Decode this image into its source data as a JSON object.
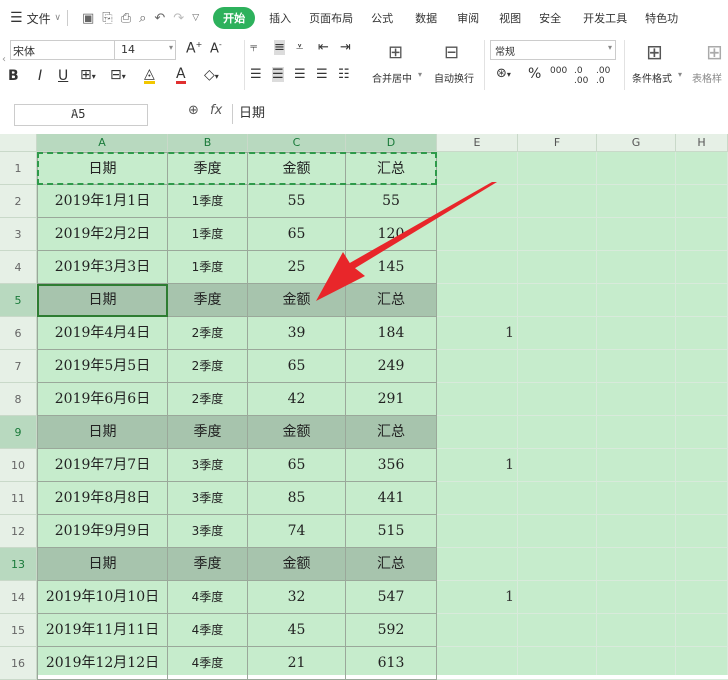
{
  "menu": {
    "file_label": "文件",
    "tabs": [
      "开始",
      "插入",
      "页面布局",
      "公式",
      "数据",
      "审阅",
      "视图",
      "安全",
      "开发工具",
      "特色功"
    ]
  },
  "ribbon": {
    "font_name": "宋体",
    "font_size": "14",
    "merge_label": "合并居中",
    "wrap_label": "自动换行",
    "number_format": "常规",
    "cond_format_label": "条件格式",
    "table_style_label": "表格样"
  },
  "formula_bar": {
    "name_box": "A5",
    "fx": "fx",
    "value": "日期"
  },
  "columns": [
    "A",
    "B",
    "C",
    "D",
    "E",
    "F",
    "G",
    "H"
  ],
  "rows": [
    {
      "num": "1",
      "type": "header",
      "a": "日期",
      "b": "季度",
      "c": "金额",
      "d": "汇总",
      "e": ""
    },
    {
      "num": "2",
      "type": "data",
      "a": "2019年1月1日",
      "b": "1季度",
      "c": "55",
      "d": "55",
      "e": ""
    },
    {
      "num": "3",
      "type": "data",
      "a": "2019年2月2日",
      "b": "1季度",
      "c": "65",
      "d": "120",
      "e": ""
    },
    {
      "num": "4",
      "type": "data",
      "a": "2019年3月3日",
      "b": "1季度",
      "c": "25",
      "d": "145",
      "e": ""
    },
    {
      "num": "5",
      "type": "header",
      "a": "日期",
      "b": "季度",
      "c": "金额",
      "d": "汇总",
      "e": ""
    },
    {
      "num": "6",
      "type": "data",
      "a": "2019年4月4日",
      "b": "2季度",
      "c": "39",
      "d": "184",
      "e": "1"
    },
    {
      "num": "7",
      "type": "data",
      "a": "2019年5月5日",
      "b": "2季度",
      "c": "65",
      "d": "249",
      "e": ""
    },
    {
      "num": "8",
      "type": "data",
      "a": "2019年6月6日",
      "b": "2季度",
      "c": "42",
      "d": "291",
      "e": ""
    },
    {
      "num": "9",
      "type": "header",
      "a": "日期",
      "b": "季度",
      "c": "金额",
      "d": "汇总",
      "e": ""
    },
    {
      "num": "10",
      "type": "data",
      "a": "2019年7月7日",
      "b": "3季度",
      "c": "65",
      "d": "356",
      "e": "1"
    },
    {
      "num": "11",
      "type": "data",
      "a": "2019年8月8日",
      "b": "3季度",
      "c": "85",
      "d": "441",
      "e": ""
    },
    {
      "num": "12",
      "type": "data",
      "a": "2019年9月9日",
      "b": "3季度",
      "c": "74",
      "d": "515",
      "e": ""
    },
    {
      "num": "13",
      "type": "header",
      "a": "日期",
      "b": "季度",
      "c": "金额",
      "d": "汇总",
      "e": ""
    },
    {
      "num": "14",
      "type": "data",
      "a": "2019年10月10日",
      "b": "4季度",
      "c": "32",
      "d": "547",
      "e": "1"
    },
    {
      "num": "15",
      "type": "data",
      "a": "2019年11月11日",
      "b": "4季度",
      "c": "45",
      "d": "592",
      "e": ""
    },
    {
      "num": "16",
      "type": "data",
      "a": "2019年12月12日",
      "b": "4季度",
      "c": "21",
      "d": "613",
      "e": ""
    }
  ],
  "colors": {
    "accent": "#2db15c",
    "arrow": "#e8262a",
    "sheet_bg": "#c6eccc",
    "header_row": "#a7c4ad"
  }
}
